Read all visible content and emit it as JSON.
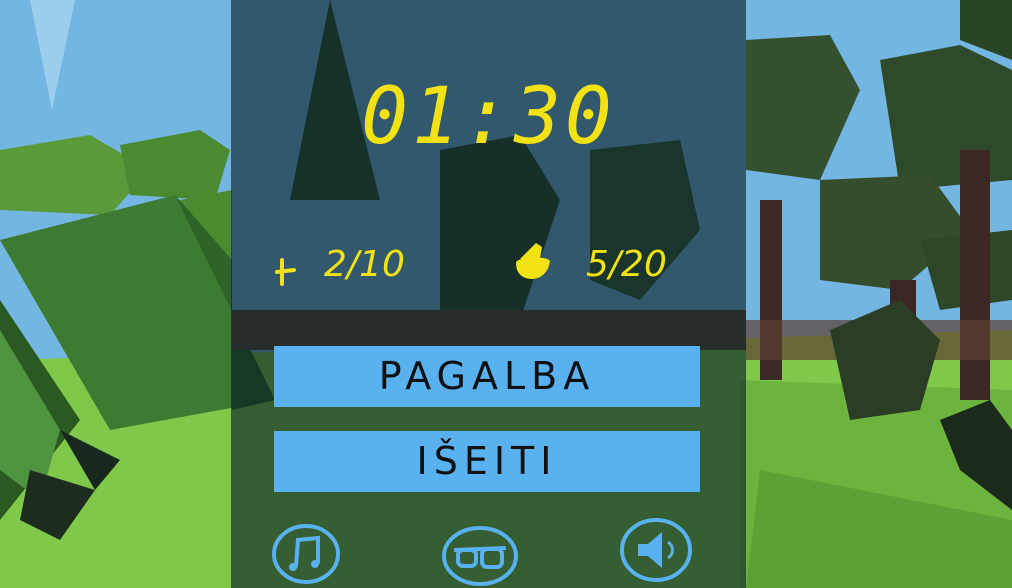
{
  "hud": {
    "timer": "01:30",
    "counter_left": {
      "icon": "arrow-marker-icon",
      "value": "2/10"
    },
    "counter_right": {
      "icon": "gnome-icon",
      "value": "5/20"
    }
  },
  "menu": {
    "help_label": "PAGALBA",
    "exit_label": "IŠEITI"
  },
  "bottom_icons": [
    "music-icon",
    "glasses-icon",
    "sound-icon"
  ],
  "colors": {
    "hud_text": "#f2e214",
    "button": "#59b2ef",
    "icon_stroke": "#59b2ef"
  }
}
